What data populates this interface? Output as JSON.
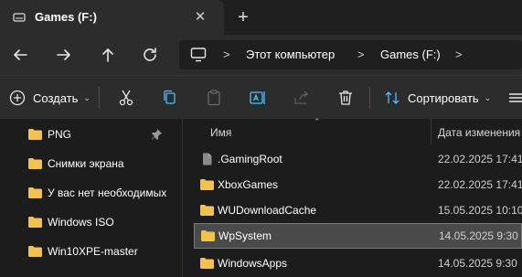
{
  "window": {
    "tab_title": "Games (F:)",
    "tab_close": "✕",
    "new_tab": "+"
  },
  "address": {
    "crumbs": [
      "Этот компьютер",
      "Games (F:)"
    ],
    "separator": ">"
  },
  "toolbar": {
    "create_label": "Создать",
    "sort_label": "Сортировать",
    "dropdown_glyph": "⌄"
  },
  "sidebar": {
    "items": [
      {
        "label": "PNG",
        "pinned": true
      },
      {
        "label": "Снимки экрана",
        "pinned": false
      },
      {
        "label": "У вас нет необходимых",
        "pinned": false
      },
      {
        "label": "Windows ISO",
        "pinned": false
      },
      {
        "label": "Win10XPE-master",
        "pinned": false
      }
    ]
  },
  "files": {
    "columns": {
      "name": "Имя",
      "date": "Дата изменения"
    },
    "rows": [
      {
        "name": ".GamingRoot",
        "date": "22.02.2025 17:41",
        "icon": "file-icon",
        "selected": false
      },
      {
        "name": "XboxGames",
        "date": "22.02.2025 17:41",
        "icon": "folder-icon",
        "selected": false
      },
      {
        "name": "WUDownloadCache",
        "date": "15.05.2025 10:10",
        "icon": "folder-icon",
        "selected": false
      },
      {
        "name": "WpSystem",
        "date": "14.05.2025 9:30",
        "icon": "folder-icon",
        "selected": true
      },
      {
        "name": "WindowsApps",
        "date": "14.05.2025 9:30",
        "icon": "folder-icon",
        "selected": false
      }
    ]
  },
  "colors": {
    "folder": "#f2c14e",
    "accent": "#4cc2ff"
  }
}
